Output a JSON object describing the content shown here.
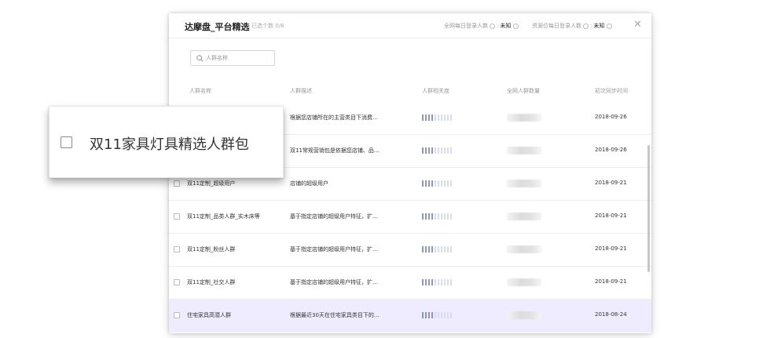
{
  "modal": {
    "title": "达摩盘_平台精选",
    "selected_label": "已选个数 0/8",
    "stat_daily_users": {
      "label": "全网每日登录人数",
      "value": "未知"
    },
    "stat_resource_users": {
      "label": "资源位每日登录人数",
      "value": "未知"
    },
    "close_icon": "close-icon"
  },
  "search": {
    "placeholder": "人群名称",
    "value": ""
  },
  "columns": [
    "人群名称",
    "人群描述",
    "人群相关度",
    "全网人群数量",
    "初次同步时间"
  ],
  "rows": [
    {
      "name": "",
      "desc": "根据您店铺所在的主营类目下消费…",
      "relevance": 4,
      "date": "2018-09-26",
      "highlighted": false
    },
    {
      "name": "",
      "desc": "双11常规营销包是依据您店铺、品…",
      "relevance": 4,
      "date": "2018-09-26",
      "highlighted": false
    },
    {
      "name": "双11定制_超级用户",
      "desc": "店铺的超级用户",
      "relevance": 4,
      "date": "2018-09-21",
      "highlighted": false
    },
    {
      "name": "双11定制_品类人群_实木床等",
      "desc": "基于指定店铺的超级用户特征，扩…",
      "relevance": 4,
      "date": "2018-09-21",
      "highlighted": false
    },
    {
      "name": "双11定制_粉丝人群",
      "desc": "基于指定店铺的超级用户特征，扩…",
      "relevance": 4,
      "date": "2018-09-21",
      "highlighted": false
    },
    {
      "name": "双11定制_社交人群",
      "desc": "基于指定店铺的超级用户特征，扩…",
      "relevance": 4,
      "date": "2018-09-21",
      "highlighted": false
    },
    {
      "name": "住宅家具高潜人群",
      "desc": "根据最近30天在住宅家具类目下的…",
      "relevance": 4,
      "date": "2018-08-24",
      "highlighted": true
    }
  ],
  "relevance_max": 10,
  "zoom_callout": {
    "label": "双11家具灯具精选人群包"
  },
  "colors": {
    "accent": "#8c93d6",
    "highlight_row": "#f0ecff",
    "bar_off": "#d9dcef"
  }
}
